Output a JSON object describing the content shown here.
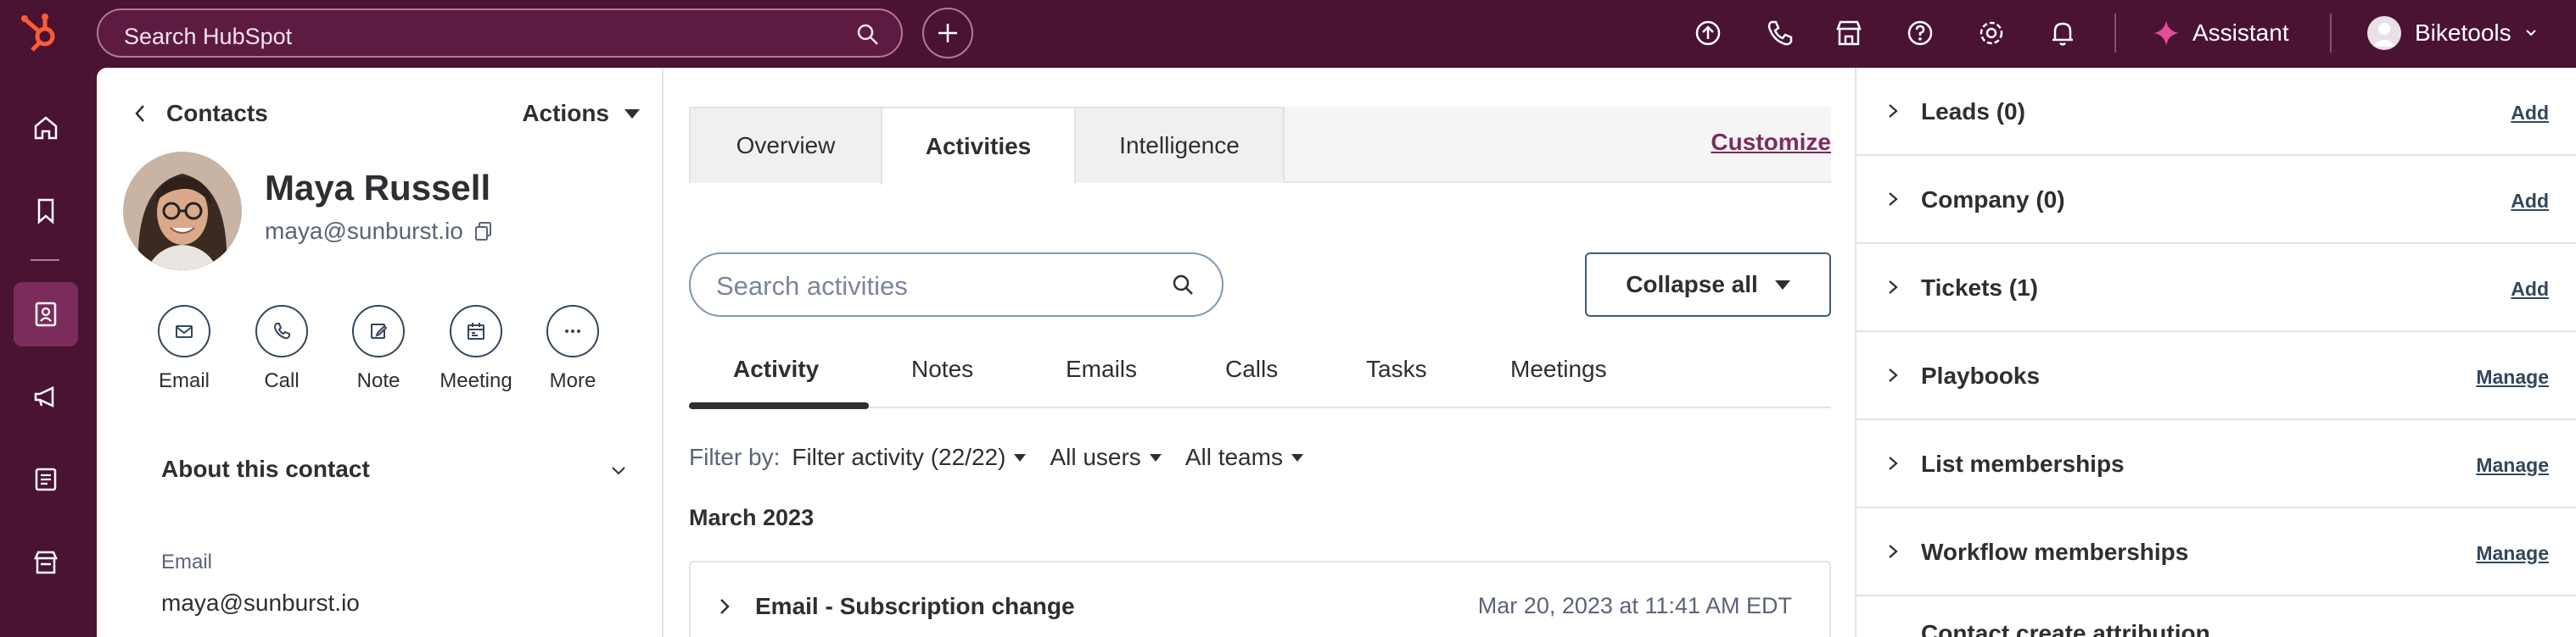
{
  "topbar": {
    "search_placeholder": "Search HubSpot",
    "assistant_label": "Assistant",
    "account_label": "Biketools",
    "icons": [
      "upgrade-icon",
      "phone-icon",
      "marketplace-icon",
      "help-icon",
      "settings-icon",
      "notifications-icon"
    ]
  },
  "contact": {
    "back_label": "Contacts",
    "actions_label": "Actions",
    "name": "Maya Russell",
    "email": "maya@sunburst.io",
    "quick_actions": [
      {
        "label": "Email",
        "icon": "email-icon"
      },
      {
        "label": "Call",
        "icon": "call-icon"
      },
      {
        "label": "Note",
        "icon": "note-icon"
      },
      {
        "label": "Meeting",
        "icon": "meeting-icon"
      },
      {
        "label": "More",
        "icon": "more-icon"
      }
    ],
    "about_title": "About this contact",
    "properties": [
      {
        "label": "Email",
        "value": "maya@sunburst.io"
      }
    ]
  },
  "main": {
    "tabs": [
      {
        "label": "Overview",
        "active": false
      },
      {
        "label": "Activities",
        "active": true
      },
      {
        "label": "Intelligence",
        "active": false
      }
    ],
    "customize_label": "Customize",
    "search_placeholder": "Search activities",
    "collapse_label": "Collapse all",
    "subtabs": [
      {
        "label": "Activity",
        "active": true
      },
      {
        "label": "Notes"
      },
      {
        "label": "Emails"
      },
      {
        "label": "Calls"
      },
      {
        "label": "Tasks"
      },
      {
        "label": "Meetings"
      }
    ],
    "filter_by_label": "Filter by:",
    "filters": [
      "Filter activity (22/22)",
      "All users",
      "All teams"
    ],
    "month": "March 2023",
    "activity": {
      "title": "Email - Subscription change",
      "timestamp": "Mar 20, 2023 at 11:41 AM EDT"
    }
  },
  "sidebar_right": {
    "cards": [
      {
        "title": "Leads (0)",
        "action": "Add"
      },
      {
        "title": "Company (0)",
        "action": "Add"
      },
      {
        "title": "Tickets (1)",
        "action": "Add"
      },
      {
        "title": "Playbooks",
        "action": "Manage"
      },
      {
        "title": "List memberships",
        "action": "Manage"
      },
      {
        "title": "Workflow memberships",
        "action": "Manage"
      }
    ],
    "partial_card_title": "Contact create attribution"
  },
  "colors": {
    "brand_dark": "#4a1332",
    "accent_link": "#7c2c5c",
    "logo_orange": "#ff5c35",
    "assistant_pink": "#e64c9c"
  }
}
